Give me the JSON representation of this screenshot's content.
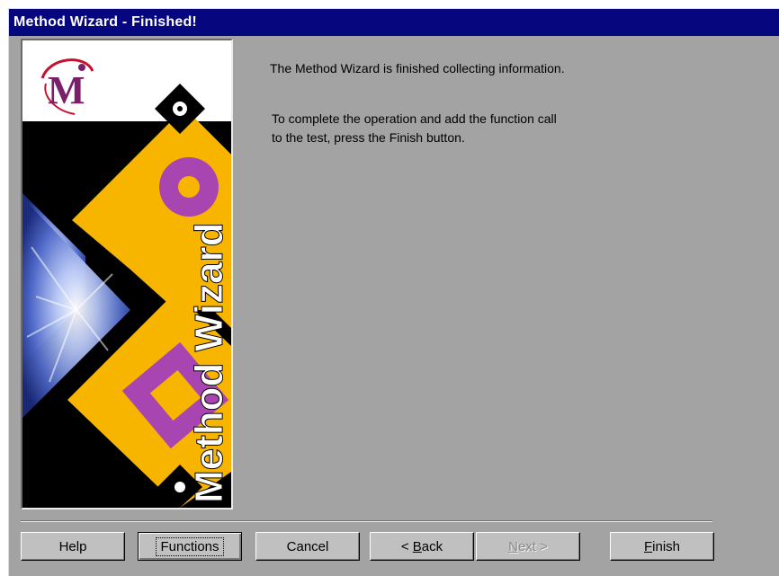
{
  "window": {
    "title": "Method Wizard - Finished!"
  },
  "banner": {
    "logo_letter": "M",
    "vertical_text": "Method Wizard",
    "colors": {
      "gold": "#f7b500",
      "purple": "#a845b0",
      "black": "#000000",
      "blue": "#4f69c8"
    }
  },
  "content": {
    "message_line1": "The Method Wizard is finished collecting information.",
    "message_line2": "To complete the operation and add the function call",
    "message_line3": "to the test, press the Finish button."
  },
  "buttons": {
    "help": "Help",
    "functions": "Functions",
    "cancel": "Cancel",
    "back": {
      "mnemonic": "B",
      "rest": "ack",
      "prefix": "< "
    },
    "next": {
      "mnemonic": "N",
      "rest": "ext >"
    },
    "finish": {
      "mnemonic": "F",
      "rest": "inish"
    }
  },
  "colors": {
    "titlebar": "#06067e",
    "dialog_bg": "#a3a3a3"
  }
}
